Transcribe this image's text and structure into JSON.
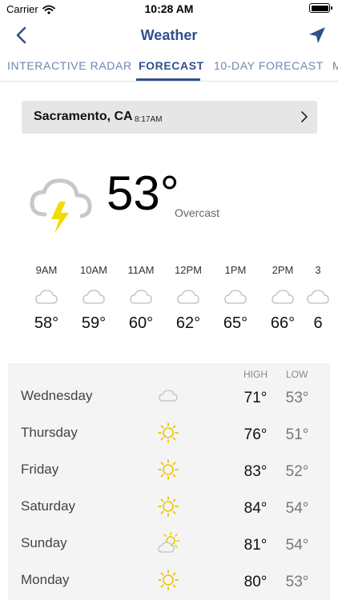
{
  "status_bar": {
    "carrier": "Carrier",
    "time": "10:28 AM"
  },
  "nav": {
    "title": "Weather"
  },
  "tabs": [
    {
      "label": "INTERACTIVE RADAR",
      "active": false
    },
    {
      "label": "FORECAST",
      "active": true
    },
    {
      "label": "10-DAY FORECAST",
      "active": false
    },
    {
      "label": "M",
      "active": false
    }
  ],
  "location": {
    "city": "Sacramento, CA",
    "local_time": "8:17AM"
  },
  "current": {
    "temperature": "53°",
    "condition": "Overcast",
    "icon": "thunderstorm-icon"
  },
  "hourly": [
    {
      "hour": "9AM",
      "temp": "58°",
      "icon": "cloud-icon"
    },
    {
      "hour": "10AM",
      "temp": "59°",
      "icon": "cloud-icon"
    },
    {
      "hour": "11AM",
      "temp": "60°",
      "icon": "cloud-icon"
    },
    {
      "hour": "12PM",
      "temp": "62°",
      "icon": "cloud-icon"
    },
    {
      "hour": "1PM",
      "temp": "65°",
      "icon": "cloud-icon"
    },
    {
      "hour": "2PM",
      "temp": "66°",
      "icon": "cloud-icon"
    },
    {
      "hour": "3",
      "temp": "6",
      "icon": "cloud-icon"
    }
  ],
  "daily_headers": {
    "high": "HIGH",
    "low": "LOW"
  },
  "daily": [
    {
      "day": "Wednesday",
      "high": "71°",
      "low": "53°",
      "icon": "cloud-icon"
    },
    {
      "day": "Thursday",
      "high": "76°",
      "low": "51°",
      "icon": "sun-icon"
    },
    {
      "day": "Friday",
      "high": "83°",
      "low": "52°",
      "icon": "sun-icon"
    },
    {
      "day": "Saturday",
      "high": "84°",
      "low": "54°",
      "icon": "sun-icon"
    },
    {
      "day": "Sunday",
      "high": "81°",
      "low": "54°",
      "icon": "partly-cloudy-icon"
    },
    {
      "day": "Monday",
      "high": "80°",
      "low": "53°",
      "icon": "sun-icon"
    }
  ],
  "colors": {
    "brand": "#2f4f8f",
    "tab_inactive": "#6d86b0",
    "sun": "#f2c200",
    "cloud": "#c8c8c8",
    "bolt": "#f2dc00"
  }
}
